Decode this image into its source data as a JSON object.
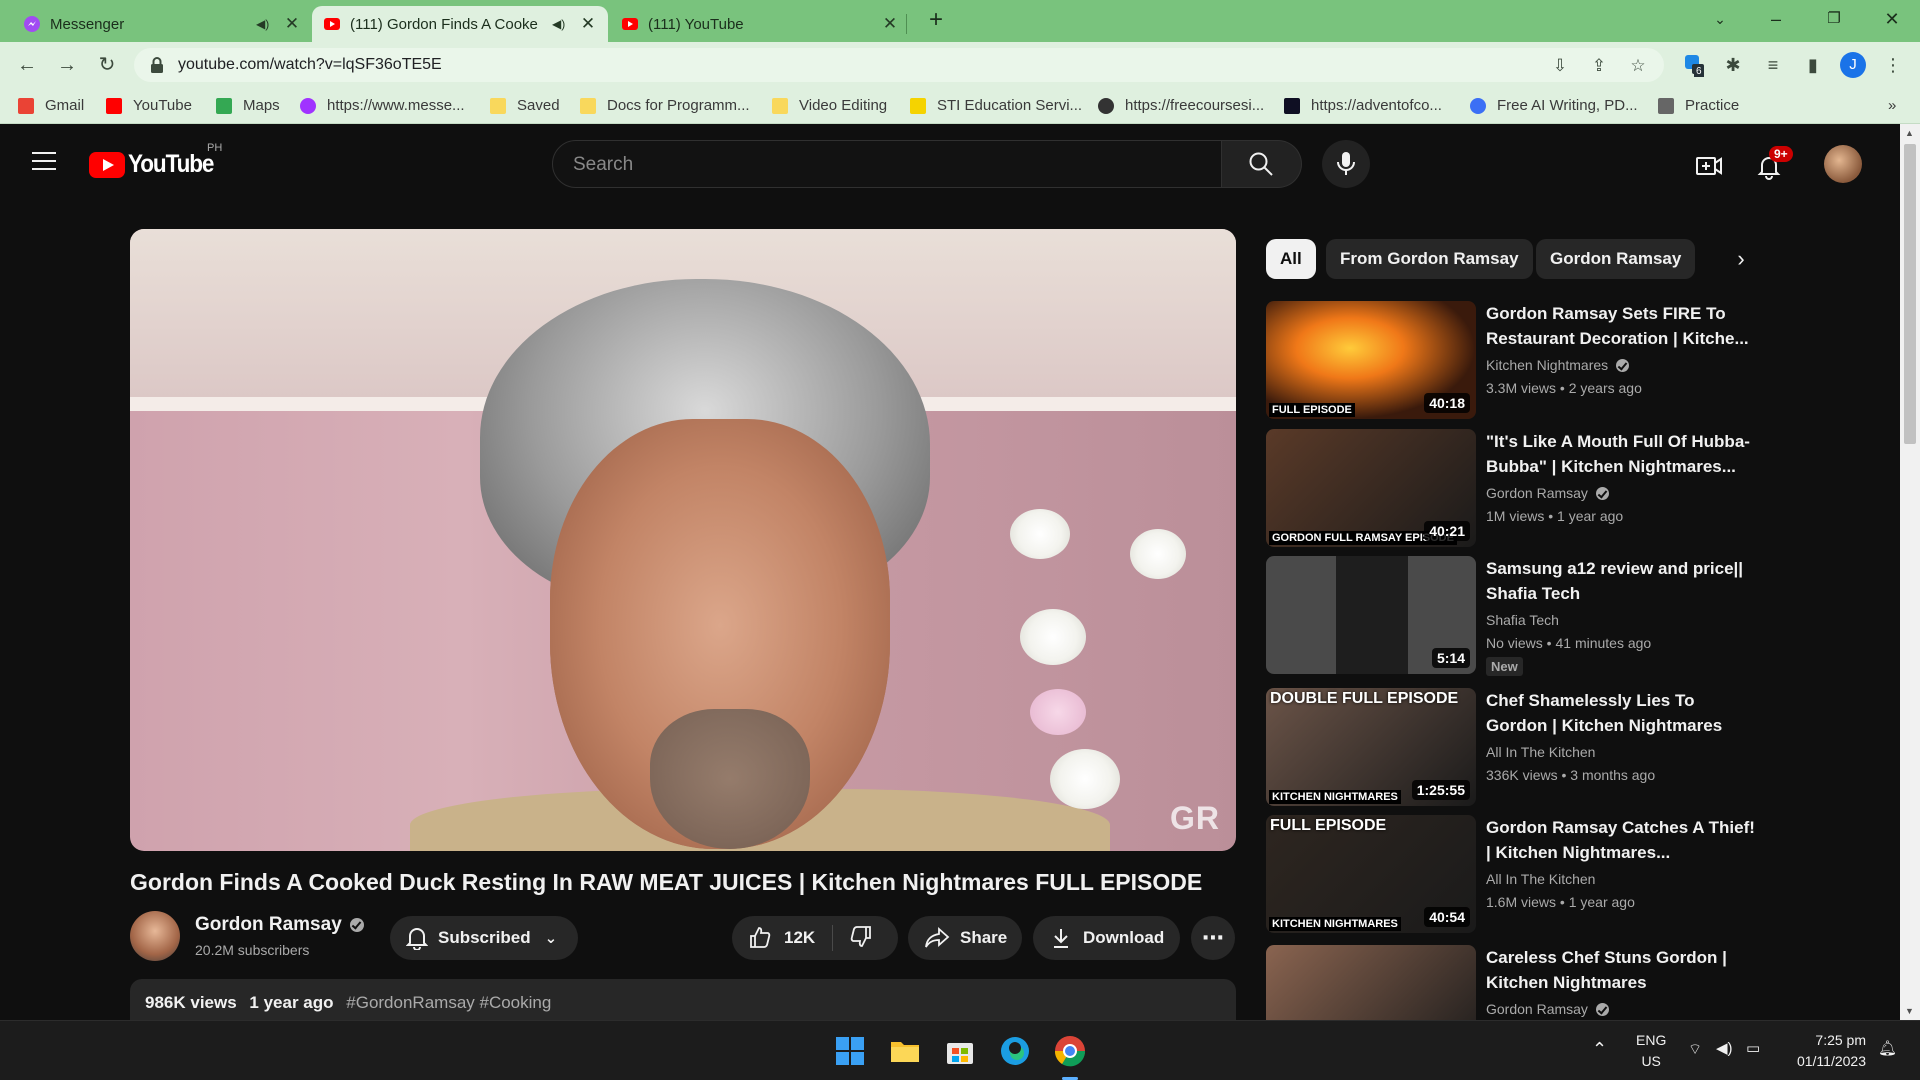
{
  "browser": {
    "tabs": [
      {
        "title": "Messenger",
        "active": false
      },
      {
        "title": "(111) Gordon Finds A Cooke",
        "active": true
      },
      {
        "title": "(111) YouTube",
        "active": false
      }
    ],
    "url": "youtube.com/watch?v=lqSF36oTE5E",
    "profile_initial": "J",
    "extension_badge": "6"
  },
  "bookmarks": [
    {
      "label": "Gmail",
      "icon": "gmail-icon",
      "color": "#ea4335"
    },
    {
      "label": "YouTube",
      "icon": "youtube-icon",
      "color": "#ff0000"
    },
    {
      "label": "Maps",
      "icon": "maps-icon",
      "color": "#34a853"
    },
    {
      "label": "https://www.messe...",
      "icon": "messenger-icon",
      "color": "#a033ff"
    },
    {
      "label": "Saved",
      "icon": "folder-icon",
      "color": "#f9d85c"
    },
    {
      "label": "Docs for Programm...",
      "icon": "folder-icon",
      "color": "#f9d85c"
    },
    {
      "label": "Video Editing",
      "icon": "folder-icon",
      "color": "#f9d85c"
    },
    {
      "label": "STI Education Servi...",
      "icon": "sti-icon",
      "color": "#f5d300"
    },
    {
      "label": "https://freecoursesi...",
      "icon": "globe-icon",
      "color": "#333333"
    },
    {
      "label": "https://adventofco...",
      "icon": "star-icon",
      "color": "#0f0f23"
    },
    {
      "label": "Free AI Writing, PD...",
      "icon": "ai-icon",
      "color": "#3b6ff5"
    },
    {
      "label": "Practice",
      "icon": "practice-icon",
      "color": "#666666"
    }
  ],
  "youtube": {
    "logo_text": "YouTube",
    "country_code": "PH",
    "search_placeholder": "Search",
    "notification_count": "9+"
  },
  "video": {
    "title": "Gordon Finds A Cooked Duck Resting In RAW MEAT JUICES | Kitchen Nightmares FULL EPISODE",
    "watermark": "GR",
    "channel": "Gordon Ramsay",
    "subscribers": "20.2M subscribers",
    "subscribe_label": "Subscribed",
    "likes": "12K",
    "share_label": "Share",
    "download_label": "Download",
    "views": "986K views",
    "age": "1 year ago",
    "hashtags": "#GordonRamsay #Cooking"
  },
  "chips": [
    "All",
    "From Gordon Ramsay",
    "Gordon Ramsay"
  ],
  "recommendations": [
    {
      "title": "Gordon Ramsay Sets FIRE To Restaurant Decoration | Kitche...",
      "channel": "Kitchen Nightmares",
      "verified": true,
      "views": "3.3M views",
      "age": "2 years ago",
      "duration": "40:18",
      "overlay_top": "",
      "overlay_bottom": "FULL EPISODE",
      "thumb_color": "#3a1a0c",
      "new": false
    },
    {
      "title": "\"It's Like A Mouth Full Of Hubba-Bubba\" | Kitchen Nightmares...",
      "channel": "Gordon Ramsay",
      "verified": true,
      "views": "1M views",
      "age": "1 year ago",
      "duration": "40:21",
      "overlay_top": "",
      "overlay_bottom": "GORDON FULL RAMSAY EPISODE",
      "thumb_color": "#5a3a28",
      "new": false
    },
    {
      "title": "Samsung a12 review and price|| Shafia Tech",
      "channel": "Shafia Tech",
      "verified": false,
      "views": "No views",
      "age": "41 minutes ago",
      "duration": "5:14",
      "overlay_top": "",
      "overlay_bottom": "",
      "thumb_color": "#3a3a3a",
      "new": true,
      "new_label": "New"
    },
    {
      "title": "Chef Shamelessly Lies To Gordon | Kitchen Nightmares",
      "channel": "All In The Kitchen",
      "verified": false,
      "views": "336K views",
      "age": "3 months ago",
      "duration": "1:25:55",
      "overlay_top": "DOUBLE FULL EPISODE",
      "overlay_bottom": "KITCHEN NIGHTMARES",
      "thumb_color": "#6b5448",
      "new": false
    },
    {
      "title": "Gordon Ramsay Catches A Thief! | Kitchen Nightmares...",
      "channel": "All In The Kitchen",
      "verified": false,
      "views": "1.6M views",
      "age": "1 year ago",
      "duration": "40:54",
      "overlay_top": "FULL EPISODE",
      "overlay_bottom": "KITCHEN NIGHTMARES",
      "thumb_color": "#2e2620",
      "new": false
    },
    {
      "title": "Careless Chef Stuns Gordon | Kitchen Nightmares",
      "channel": "Gordon Ramsay",
      "verified": true,
      "views": "",
      "age": "",
      "duration": "",
      "overlay_top": "",
      "overlay_bottom": "",
      "thumb_color": "#8a6450",
      "new": false
    }
  ],
  "taskbar": {
    "lang_top": "ENG",
    "lang_bottom": "US",
    "time": "7:25 pm",
    "date": "01/11/2023"
  }
}
